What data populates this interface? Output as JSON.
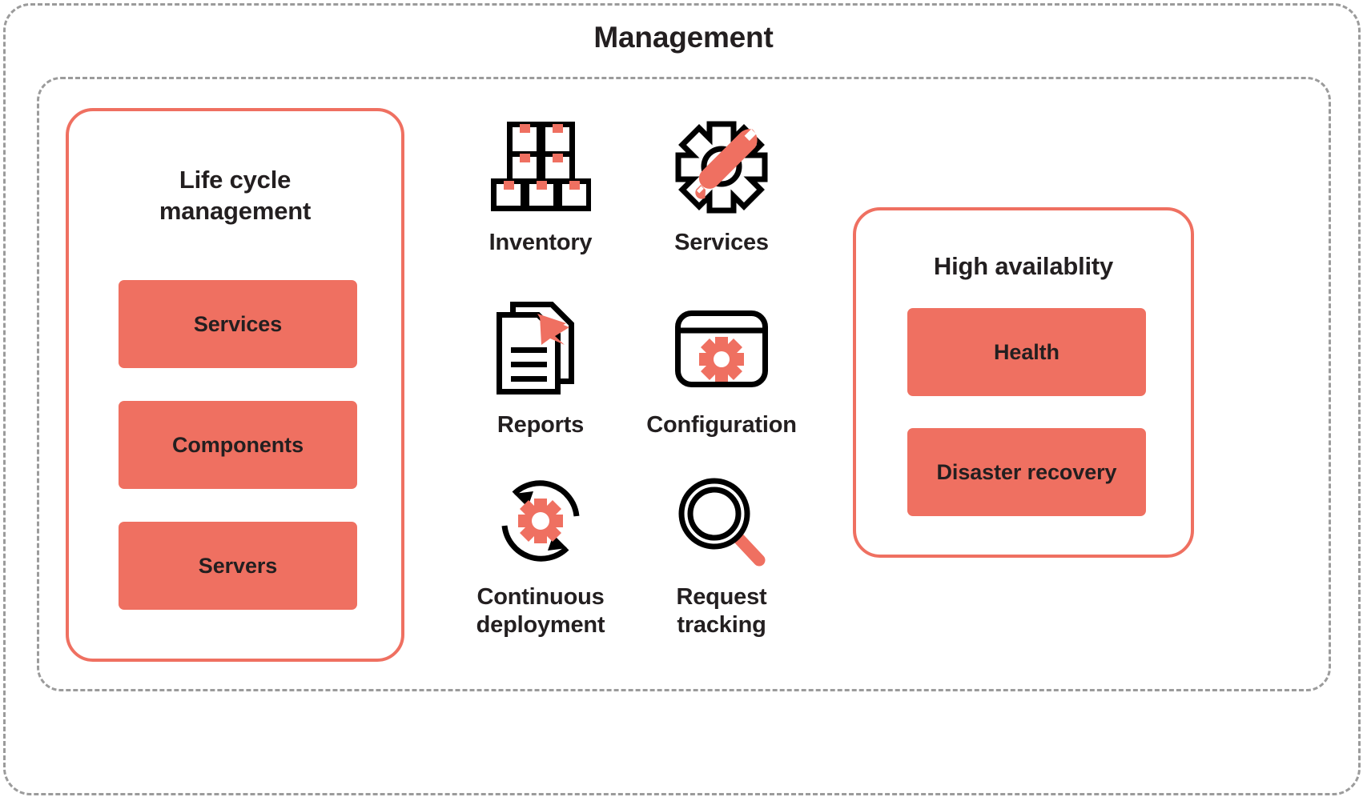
{
  "diagram": {
    "title": "Management",
    "colors": {
      "coral": "#ef7061",
      "ink": "#231f20",
      "dashed_border": "#9b9b9b",
      "background": "#ffffff"
    }
  },
  "left_card": {
    "title": "Life cycle\nmanagement",
    "title_line1": "Life cycle",
    "title_line2": "management",
    "blocks": [
      {
        "label": "Services"
      },
      {
        "label": "Components"
      },
      {
        "label": "Servers"
      }
    ]
  },
  "right_card": {
    "title": "High availablity",
    "blocks": [
      {
        "label": "Health"
      },
      {
        "label": "Disaster recovery"
      }
    ]
  },
  "icons": [
    {
      "label": "Inventory",
      "label_line1": "Inventory",
      "label_line2": "",
      "icon": "boxes-stack-icon"
    },
    {
      "label": "Services",
      "label_line1": "Services",
      "label_line2": "",
      "icon": "gear-wrench-icon"
    },
    {
      "label": "Reports",
      "label_line1": "Reports",
      "label_line2": "",
      "icon": "documents-icon"
    },
    {
      "label": "Configuration",
      "label_line1": "Configuration",
      "label_line2": "",
      "icon": "window-gear-icon"
    },
    {
      "label": "Continuous deployment",
      "label_line1": "Continuous",
      "label_line2": "deployment",
      "icon": "refresh-gear-icon"
    },
    {
      "label": "Request tracking",
      "label_line1": "Request",
      "label_line2": "tracking",
      "icon": "magnifier-icon"
    }
  ]
}
